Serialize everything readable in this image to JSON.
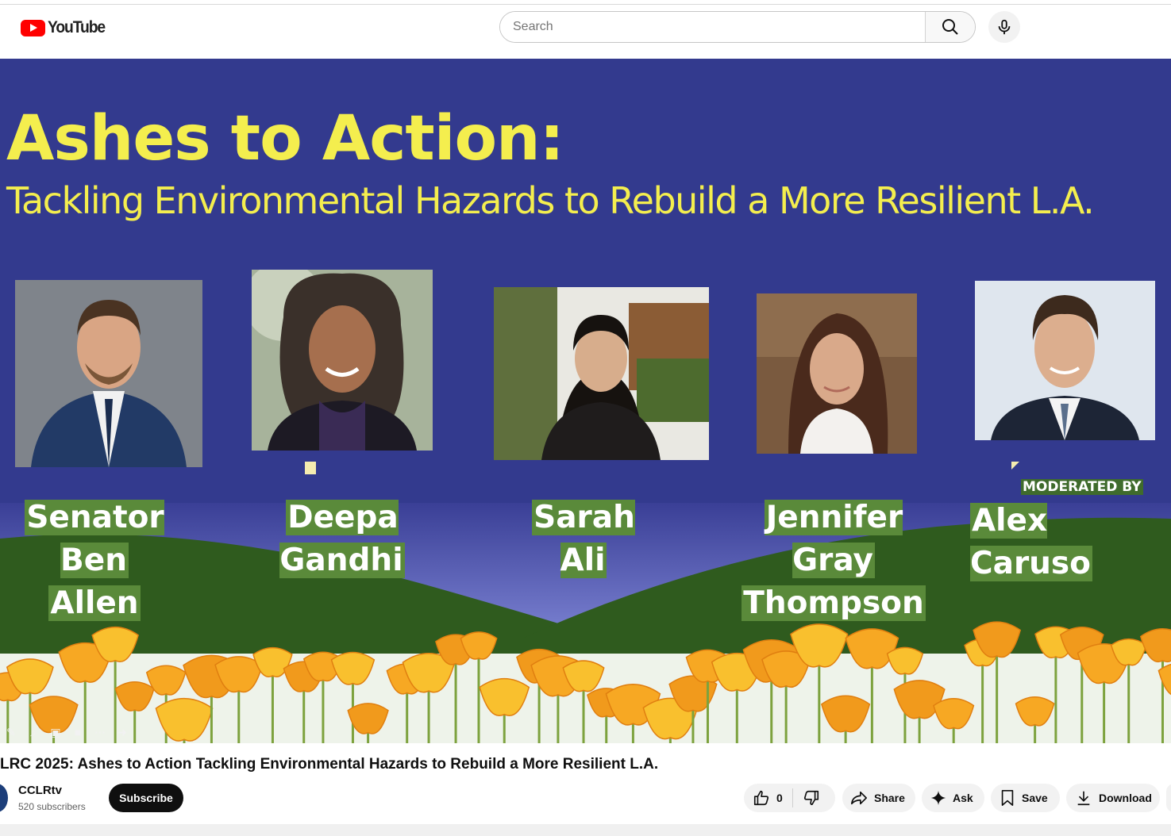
{
  "header": {
    "logo_text": "YouTube",
    "search_placeholder": "Search"
  },
  "video": {
    "headline": "Ashes to Action:",
    "subheadline": "Tackling Environmental Hazards to Rebuild a More Resilient L.A.",
    "panelists": [
      {
        "line1": "Senator Ben",
        "line2": "Allen"
      },
      {
        "line1": "Deepa Gandhi",
        "line2": ""
      },
      {
        "line1": "Sarah Ali",
        "line2": ""
      },
      {
        "line1": "Jennifer Gray",
        "line2": "Thompson"
      },
      {
        "line1": "Alex Caruso",
        "line2": ""
      }
    ],
    "moderated_label": "MODERATED BY"
  },
  "info": {
    "title": "LRC 2025: Ashes to Action Tackling Environmental Hazards to Rebuild a More Resilient L.A.",
    "channel_name": "CCLRtv",
    "subscribers": "520 subscribers",
    "subscribe_label": "Subscribe",
    "like_count": "0",
    "share_label": "Share",
    "ask_label": "Ask",
    "save_label": "Save",
    "download_label": "Download"
  },
  "colors": {
    "slide_background": "#333a8e",
    "headline_yellow": "#f4ee4e",
    "name_highlight": "#5a8a3a",
    "brand_red": "#ff0000"
  }
}
